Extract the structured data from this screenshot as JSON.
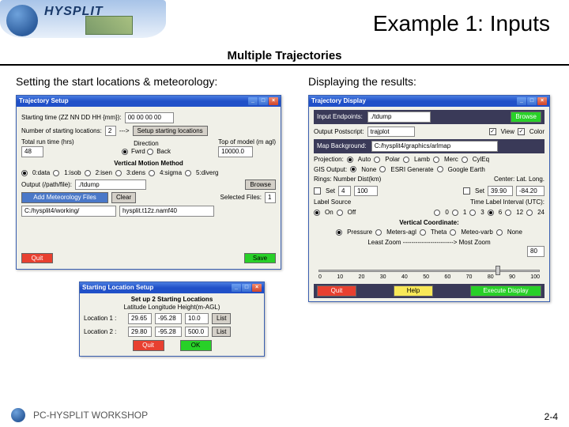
{
  "header": {
    "brand": "HYSPLIT",
    "title": "Example 1: Inputs",
    "subtitle": "Multiple Trajectories"
  },
  "left": {
    "heading": "Setting the start locations & meteorology:",
    "win1": {
      "title": "Trajectory Setup",
      "start_time_lbl": "Starting time (ZZ NN DD HH {mm}):",
      "start_time_val": "00 00 00 00",
      "nloc_lbl": "Number of starting locations:",
      "nloc_val": "2",
      "arrow": "--->",
      "setup_btn": "Setup starting locations",
      "runtime_lbl": "Total run time (hrs)",
      "runtime_val": "48",
      "dir_lbl": "Direction",
      "dir_fwd": "Fwrd",
      "dir_back": "Back",
      "top_lbl": "Top of model (m agl)",
      "top_val": "10000.0",
      "vmm_head": "Vertical Motion Method",
      "vmm_opts": [
        "0:data",
        "1:isob",
        "2:isen",
        "3:dens",
        "4:sigma",
        "5:diverg"
      ],
      "out_lbl": "Output (/path/file):",
      "out_val": "./tdump",
      "browse": "Browse",
      "add_met": "Add Meteorology Files",
      "clear": "Clear",
      "sel_lbl": "Selected Files:",
      "sel_val": "1",
      "metpath": "C:/hysplit4/working/",
      "metfile": "hysplit.t12z.namf40",
      "quit": "Quit",
      "save": "Save"
    },
    "win2": {
      "title": "Starting Location Setup",
      "head": "Set up 2 Starting Locations",
      "sub": "Latitude Longitude Height(m-AGL)",
      "loc1_lbl": "Location 1 :",
      "loc1_lat": "29.65",
      "loc1_lon": "-95.28",
      "loc1_ht": "10.0",
      "loc2_lbl": "Location 2 :",
      "loc2_lat": "29.80",
      "loc2_lon": "-95.28",
      "loc2_ht": "500.0",
      "list": "List",
      "quit": "Quit",
      "ok": "OK"
    }
  },
  "right": {
    "heading": "Displaying the results:",
    "win": {
      "title": "Trajectory Display",
      "in_lbl": "Input Endpoints:",
      "in_val": "./tdump",
      "browse": "Browse",
      "out_lbl": "Output Postscript:",
      "out_val": "trajplot",
      "view": "View",
      "color": "Color",
      "map_lbl": "Map Background:",
      "map_val": "C:/hysplit4/graphics/arlmap",
      "proj_lbl": "Projection:",
      "proj_opts": [
        "Auto",
        "Polar",
        "Lamb",
        "Merc",
        "CylEq"
      ],
      "gis_lbl": "GIS Output:",
      "gis_opts": [
        "None",
        "ESRI Generate",
        "Google Earth"
      ],
      "rings_lbl": "Rings: Number  Dist(km)",
      "rings_set": "Set",
      "rings_num": "4",
      "rings_dist": "100",
      "center_lbl": "Center:   Lat.    Long.",
      "center_set": "Set",
      "center_lat": "39.90",
      "center_lon": "-84.20",
      "labsrc_lbl": "Label Source",
      "labsrc_opts": [
        "On",
        "Off"
      ],
      "timelbl_lbl": "Time Label Interval (UTC):",
      "timelbl_opts": [
        "0",
        "1",
        "3",
        "6",
        "12",
        "24"
      ],
      "vert_head": "Vertical Coordinate:",
      "vert_opts": [
        "Pressure",
        "Meters-agl",
        "Theta",
        "Meteo-varb",
        "None"
      ],
      "zoom_lbl": "Least Zoom ------------------------> Most Zoom",
      "zoom_val": "80",
      "ticks": [
        "0",
        "10",
        "20",
        "30",
        "40",
        "50",
        "60",
        "70",
        "80",
        "90",
        "100"
      ],
      "quit": "Quit",
      "help": "Help",
      "exec": "Execute Display"
    }
  },
  "footer": {
    "text": "PC-HYSPLIT WORKSHOP",
    "page": "2-4"
  }
}
